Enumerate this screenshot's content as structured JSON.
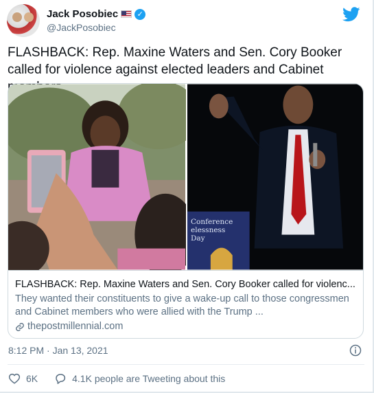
{
  "author": {
    "display_name": "Jack Posobiec",
    "handle": "@JackPosobiec",
    "flag": "US flag",
    "verified": "verified-badge"
  },
  "tweet": {
    "text": "FLASHBACK: Rep. Maxine Waters and Sen. Cory Booker called for violence against elected leaders and Cabinet members",
    "timestamp": "8:12 PM · Jan 13, 2021"
  },
  "card": {
    "title": "FLASHBACK: Rep. Maxine Waters and Sen. Cory Booker called for violenc...",
    "description": "They wanted their constituents to give a wake-up call to those congressmen and Cabinet members who were allied with the Trump ...",
    "domain": "thepostmillennial.com",
    "image_sign_text": "Conference\nelessness\nDay"
  },
  "engagement": {
    "likes": "6K",
    "conversation": "4.1K people are Tweeting about this"
  },
  "colors": {
    "brand": "#1da1f2",
    "secondary_text": "#5b7083",
    "border": "#cfd9de"
  }
}
